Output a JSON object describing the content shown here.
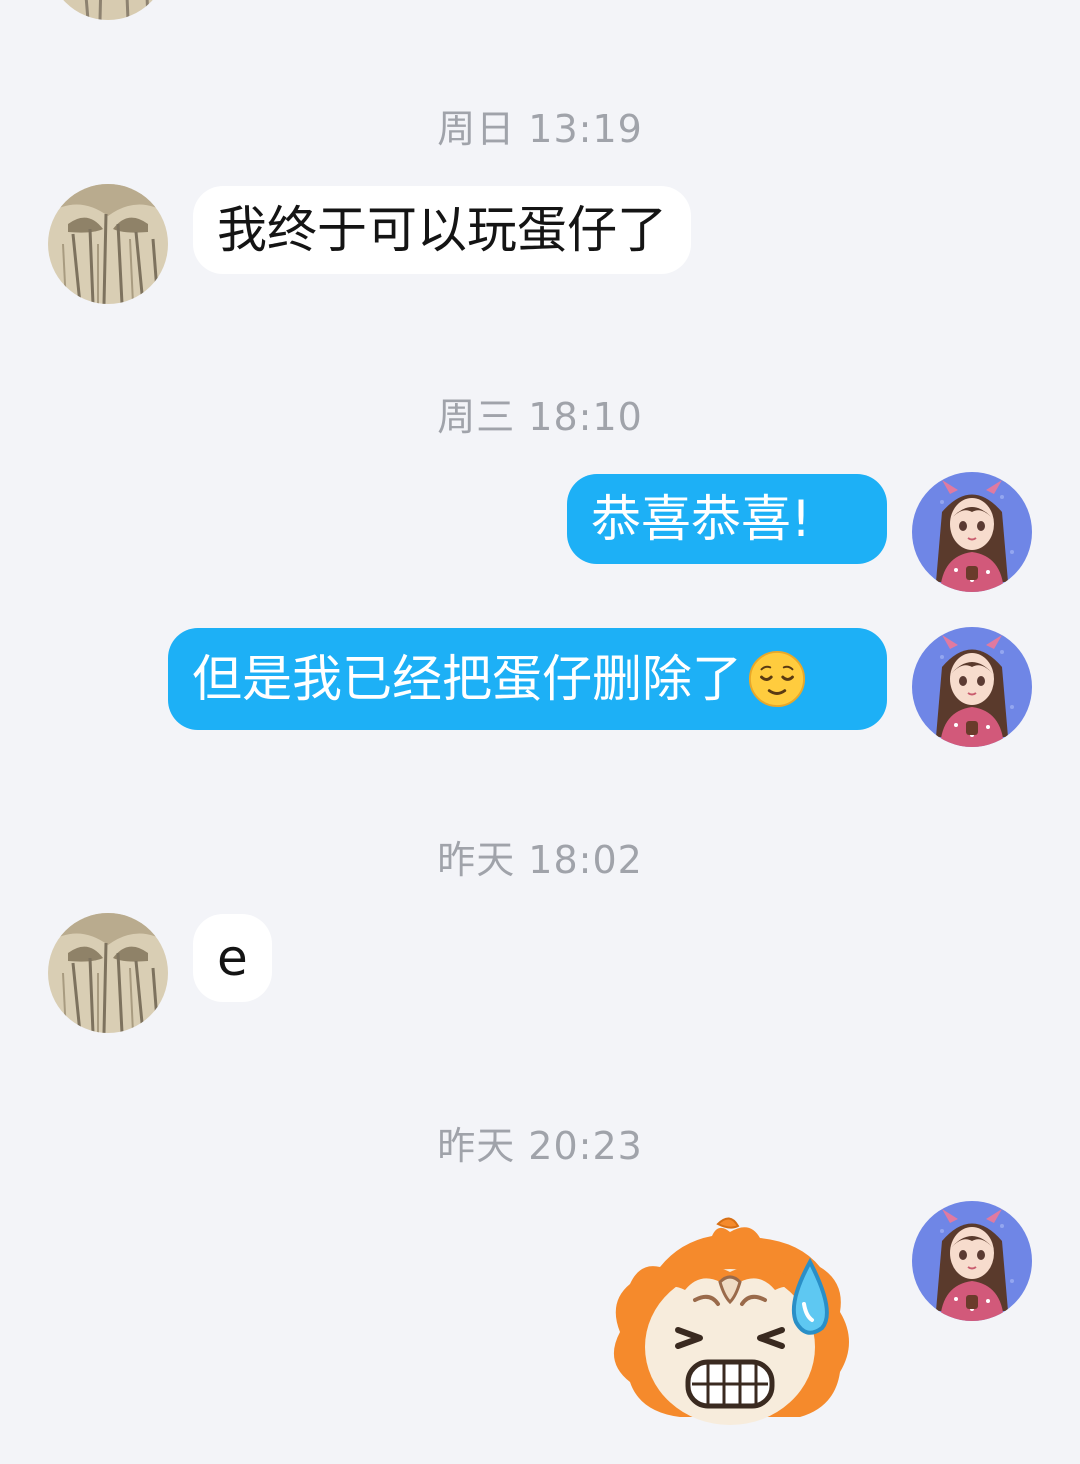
{
  "conversation": {
    "timestamps": [
      "周日 13:19",
      "周三 18:10",
      "昨天 18:02",
      "昨天 20:23"
    ],
    "messages": [
      {
        "sender": "contact",
        "text": "我终于可以玩蛋仔了"
      },
      {
        "sender": "me",
        "text": "恭喜恭喜!"
      },
      {
        "sender": "me",
        "text": "但是我已经把蛋仔删除了",
        "emoji": "relieved-face-emoji"
      },
      {
        "sender": "contact",
        "text": "e"
      },
      {
        "sender": "me",
        "sticker": "sweating-gritted-teeth-sticker"
      }
    ]
  },
  "colors": {
    "background": "#f3f4f8",
    "incoming_bubble": "#ffffff",
    "outgoing_bubble": "#1db0f6",
    "timestamp_text": "#a0a3aa"
  }
}
